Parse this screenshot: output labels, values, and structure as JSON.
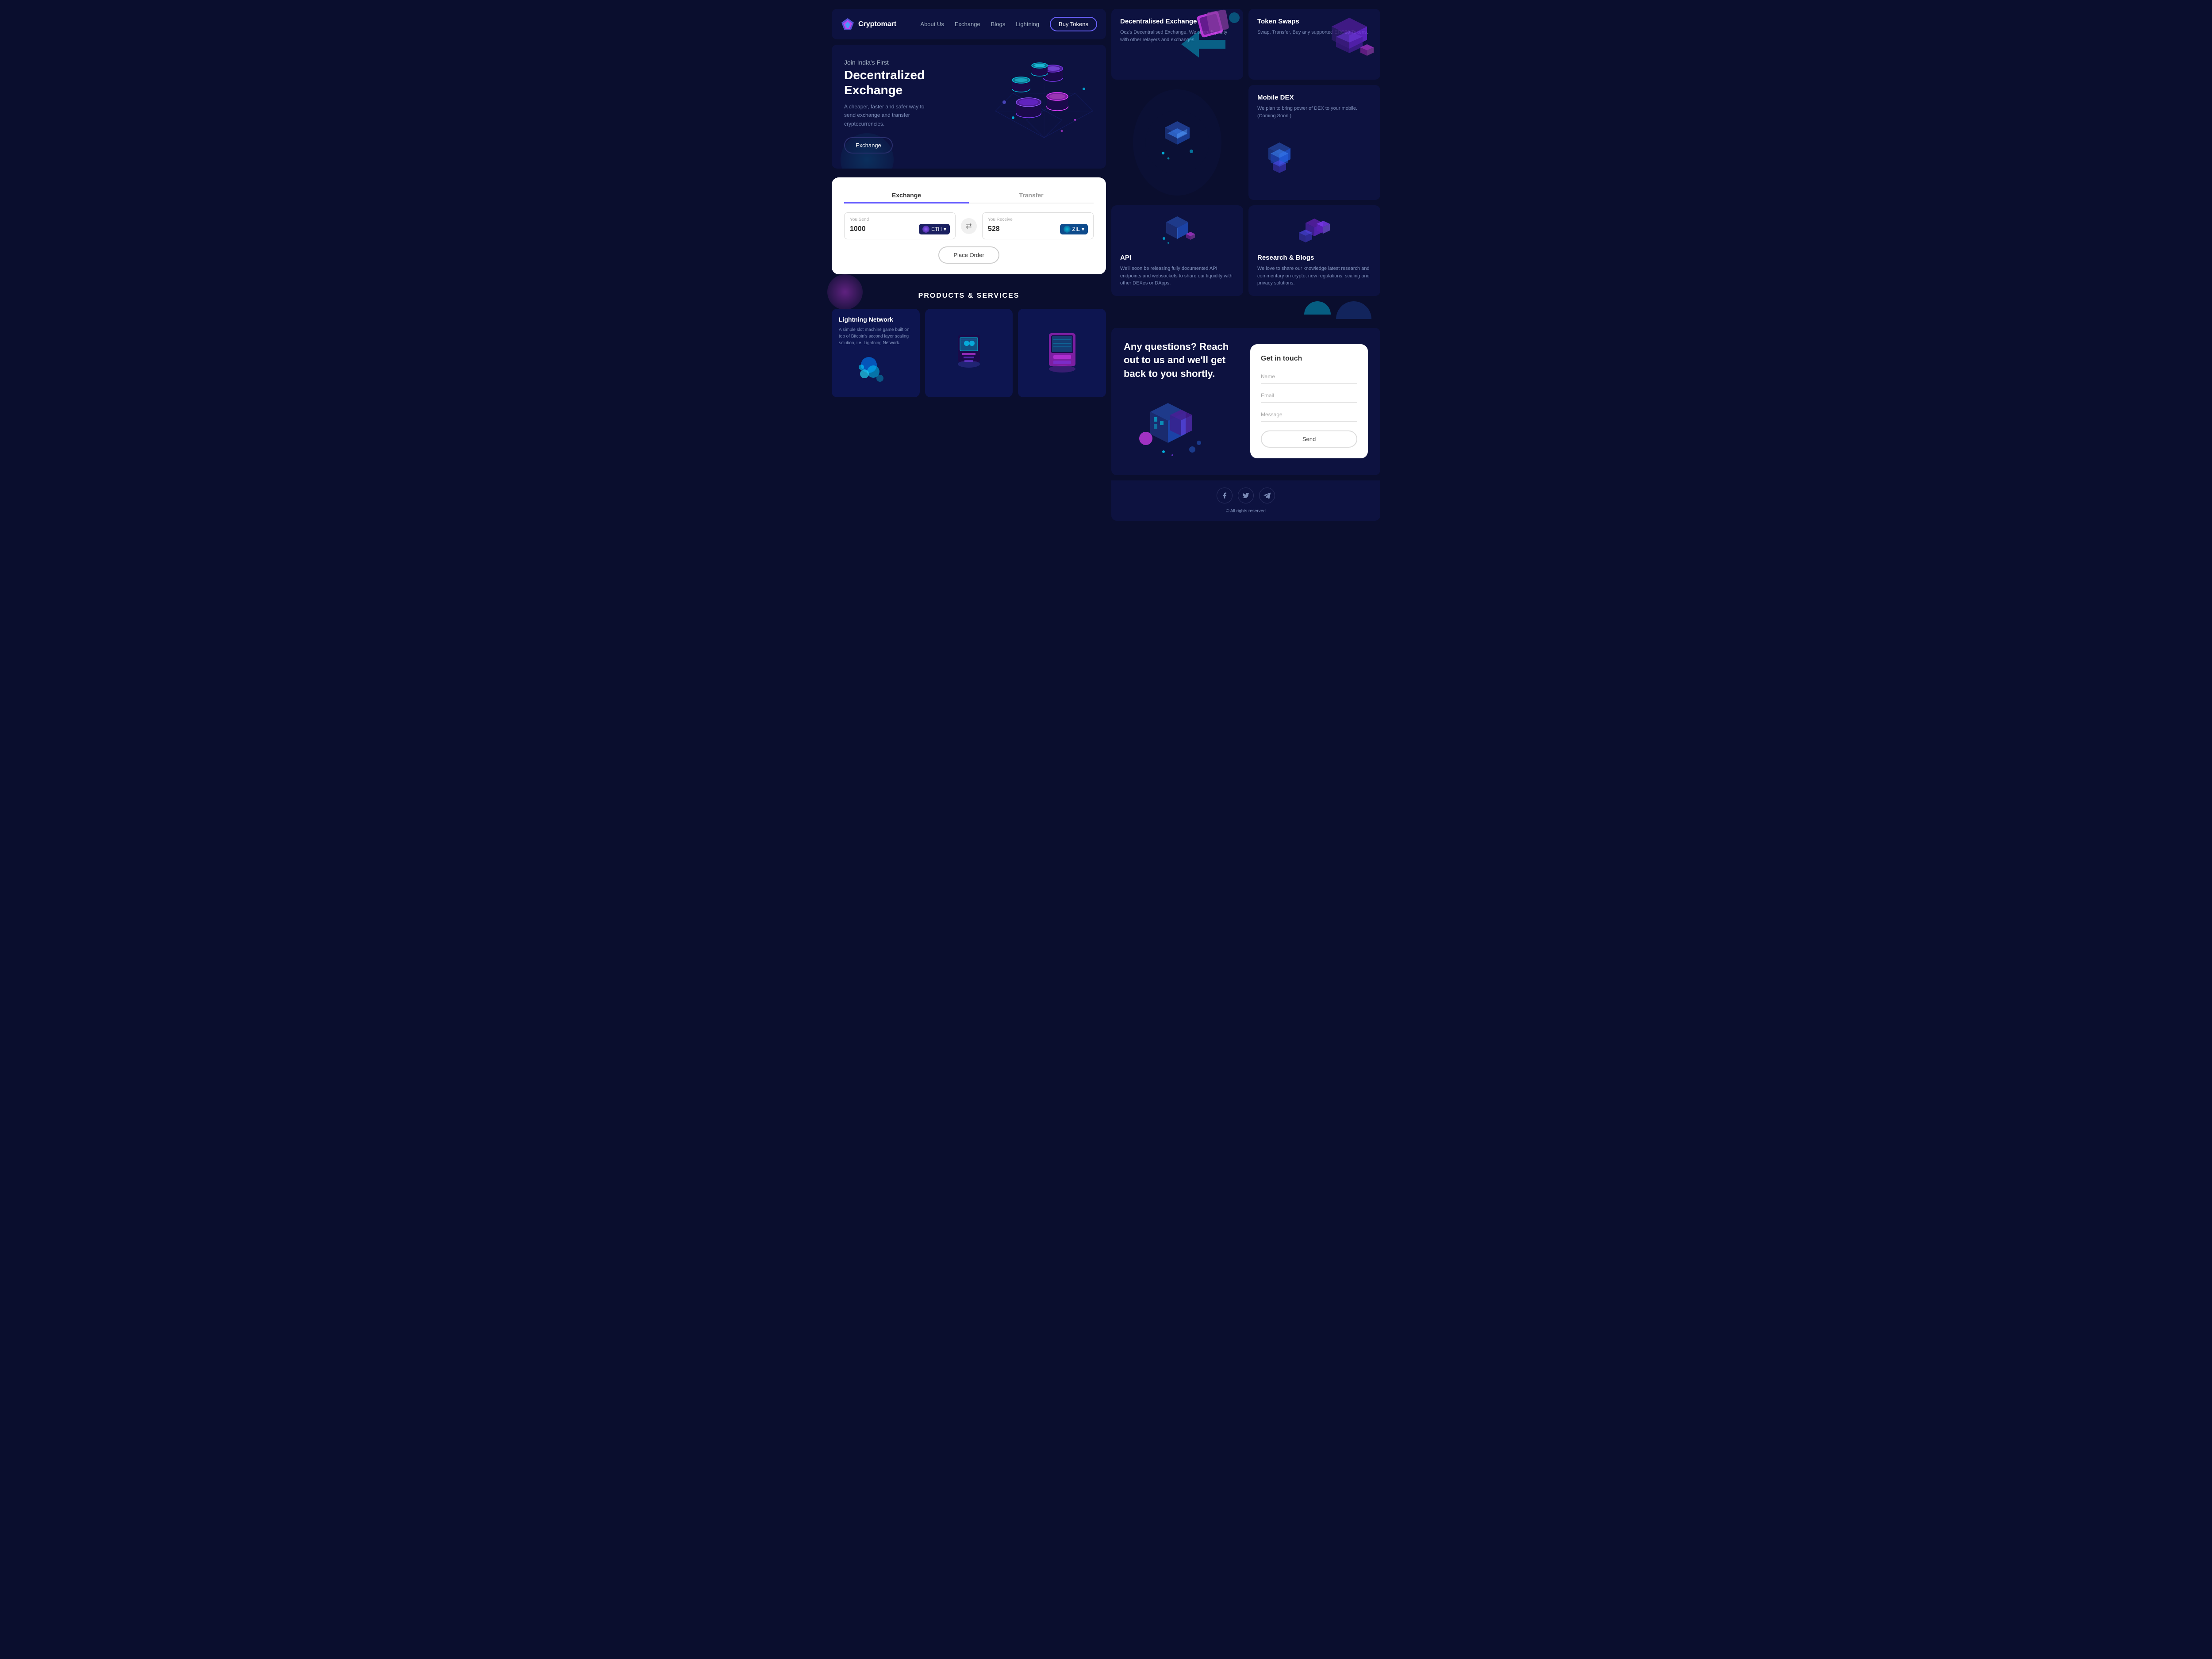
{
  "brand": {
    "name": "Cryptomart",
    "logo_shape": "diamond"
  },
  "navbar": {
    "links": [
      "About Us",
      "Exchange",
      "Blogs",
      "Lightning"
    ],
    "cta_label": "Buy Tokens"
  },
  "hero": {
    "subtitle": "Join India's First",
    "title": "Decentralized Exchange",
    "description": "A cheaper, faster and safer way to send exchange and transfer cryptocurrencies.",
    "cta_label": "Exchange"
  },
  "exchange_card": {
    "tabs": [
      "Exchange",
      "Transfer"
    ],
    "active_tab": "Exchange",
    "send_label": "You Send",
    "send_value": "1000",
    "send_token": "ETH",
    "receive_label": "You Receive",
    "receive_value": "528",
    "receive_token": "ZIL",
    "cta_label": "Place Order"
  },
  "products_section": {
    "title": "PRODUCTS & SERVICES",
    "cards": [
      {
        "title": "Lightning Network",
        "desc": "A simple slot machine game built on top of Bitcoin's second layer scaling solution, i.e. Lightning Network."
      },
      {
        "title": "",
        "desc": ""
      },
      {
        "title": "",
        "desc": ""
      }
    ]
  },
  "services": {
    "top_row": [
      {
        "title": "Decentralised Exchange",
        "desc": "Ocz's Decentralised Exchange. We share liquidity with other relayers and exchanges."
      },
      {
        "title": "Token Swaps",
        "desc": "Swap, Transfer, Buy any supported ERC20 Tokens."
      }
    ],
    "middle_row": [
      {
        "title": "Mobile DEX",
        "desc": "We plan to bring power of DEX to your mobile. (Coming Soon.)"
      }
    ],
    "bottom_row": [
      {
        "title": "API",
        "desc": "We'll soon be releasing fully documented API endpoints and websockets to share our liquidity with other DEXes or DApps."
      },
      {
        "title": "Research & Blogs",
        "desc": "We love to share our knowledge latest research and commentary on crypto, new regulations, scaling and privacy solutions."
      }
    ]
  },
  "contact": {
    "heading": "Any questions? Reach out to us and we'll get back to you shortly.",
    "form": {
      "title": "Get in touch",
      "name_placeholder": "Name",
      "email_placeholder": "Email",
      "message_placeholder": "Message",
      "submit_label": "Send"
    }
  },
  "footer": {
    "social": [
      "facebook",
      "twitter",
      "telegram"
    ],
    "copyright": "© All rights reserved"
  },
  "colors": {
    "bg_dark": "#0a0e2e",
    "bg_card": "#0d1240",
    "accent_purple": "#6c63ff",
    "accent_cyan": "#00d4ff",
    "accent_pink": "#e040fb",
    "text_muted": "#7a8ab5"
  }
}
